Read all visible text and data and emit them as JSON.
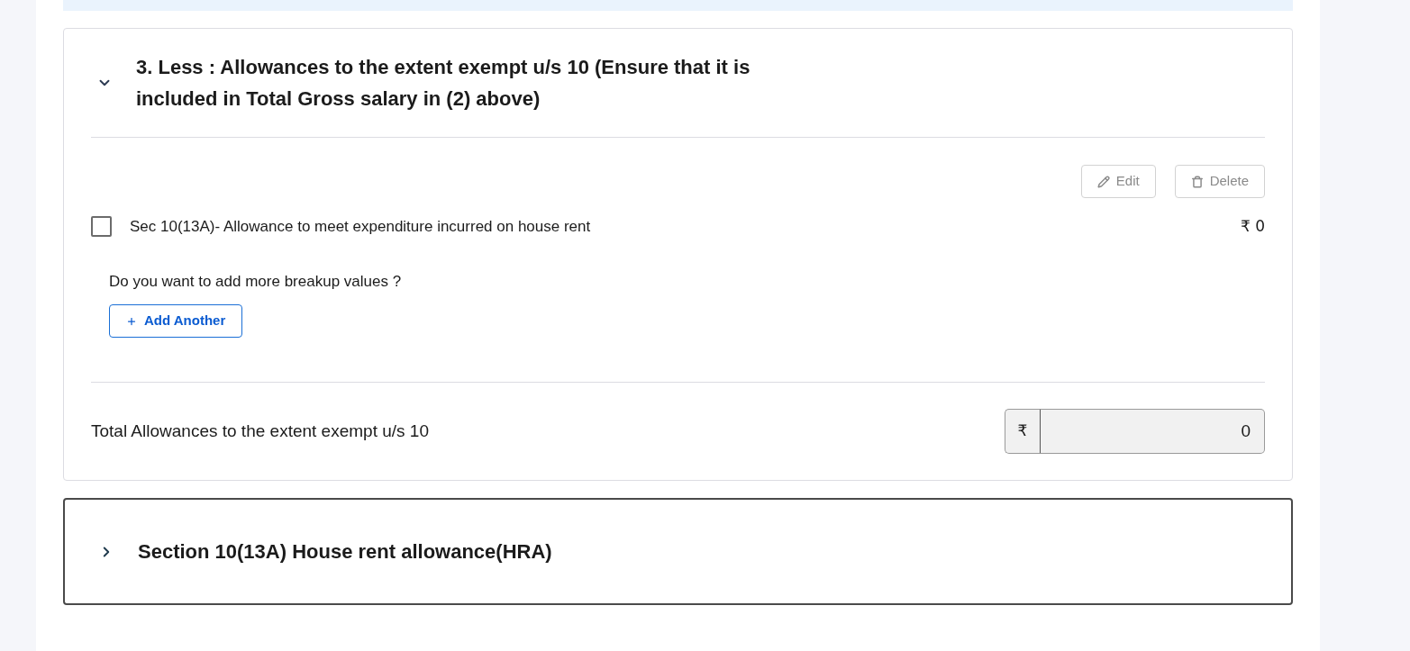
{
  "sections": [
    {
      "title": "3. Less : Allowances to the extent exempt u/s 10 (Ensure that it is included in Total Gross salary in (2) above)",
      "expanded": true,
      "focused": false,
      "actions": [
        {
          "kind": "edit",
          "label": "Edit",
          "disabled": true
        },
        {
          "kind": "delete",
          "label": "Delete",
          "disabled": true
        }
      ],
      "items": [
        {
          "label": "Sec 10(13A)- Allowance to meet expenditure incurred on house rent",
          "amount": "₹ 0",
          "checked": false
        }
      ],
      "add_more": {
        "prompt": "Do you want to add more breakup values ?",
        "button": "Add Another"
      },
      "total": {
        "label": "Total Allowances to the extent exempt u/s 10",
        "currency": "₹",
        "value": "0"
      }
    },
    {
      "title": "Section 10(13A) House rent allowance(HRA)",
      "expanded": false,
      "focused": true
    }
  ]
}
